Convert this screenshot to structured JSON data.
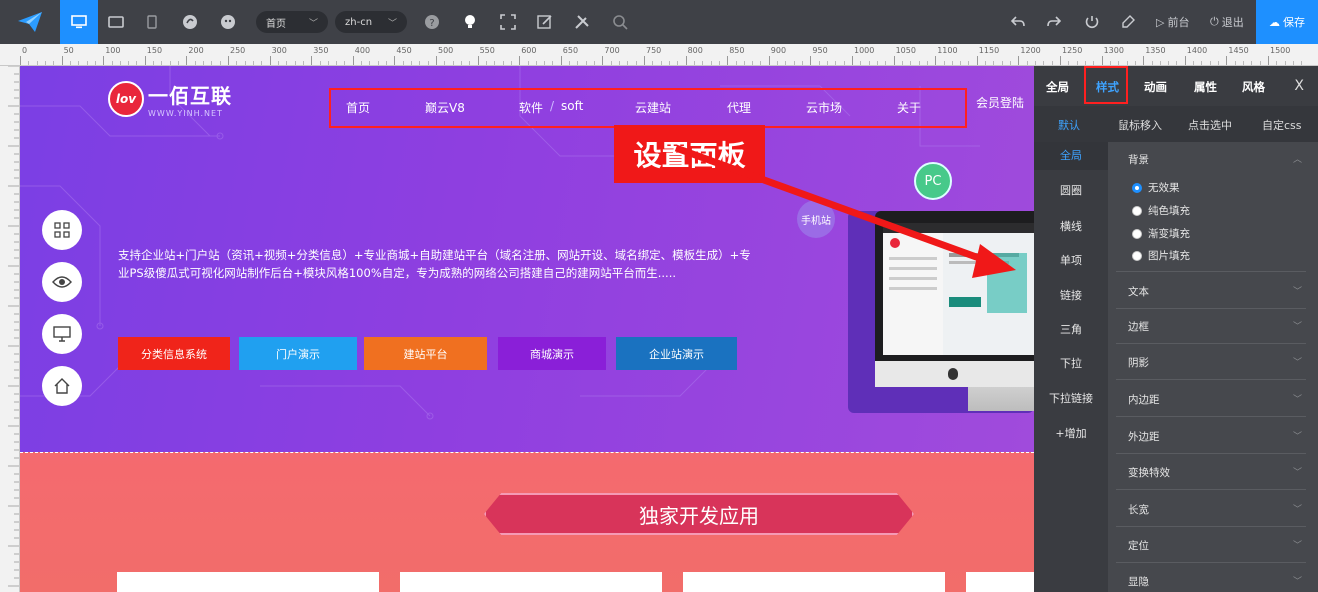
{
  "toolbar": {
    "lang_page": "首页",
    "lang_code": "zh-cn",
    "front_label": "前台",
    "logout_label": "退出",
    "save_label": "保存"
  },
  "ruler": {
    "marks": [
      "0",
      "50",
      "100",
      "150",
      "200",
      "250",
      "300",
      "350",
      "400",
      "450",
      "500",
      "550",
      "600",
      "650",
      "700",
      "750",
      "800",
      "850",
      "900",
      "950",
      "1000",
      "1050",
      "1100",
      "1150",
      "1200",
      "1250",
      "1300",
      "1350",
      "1400",
      "1450",
      "1500"
    ]
  },
  "site": {
    "brand_name": "一佰互联",
    "brand_sub": "WWW.YINH.NET",
    "brand_logo": "lov",
    "nav": [
      "首页",
      "巅云V8",
      "软件",
      "/",
      "soft",
      "云建站",
      "代理",
      "云市场",
      "关于"
    ],
    "member_login": "会员登陆",
    "intro": "支持企业站+门户站（资讯+视频+分类信息）+专业商城+自助建站平台（域名注册、网站开设、域名绑定、模板生成）+专业PS级傻瓜式可视化网站制作后台+模块风格100%自定，专为成熟的网络公司搭建自己的建网站平台而生.....",
    "cta": [
      {
        "label": "分类信息系统",
        "color": "#f0241a"
      },
      {
        "label": "门户演示",
        "color": "#20a0f0"
      },
      {
        "label": "建站平台",
        "color": "#f07020"
      },
      {
        "label": "商城演示",
        "color": "#8a1fd8"
      },
      {
        "label": "企业站演示",
        "color": "#1a72c0"
      }
    ],
    "pc_badge": "PC",
    "mobile_badge": "手机站",
    "callout": "设置面板",
    "section_title": "独家开发应用"
  },
  "panel": {
    "tabs": [
      "全局",
      "样式",
      "动画",
      "属性",
      "风格"
    ],
    "close": "X",
    "states": [
      "默认",
      "鼠标移入",
      "点击选中",
      "自定css"
    ],
    "side": [
      "全局",
      "圆圈",
      "横线",
      "单项",
      "链接",
      "三角",
      "下拉",
      "下拉链接",
      "+增加"
    ],
    "bg_title": "背景",
    "bg_options": [
      "无效果",
      "纯色填充",
      "渐变填充",
      "图片填充"
    ],
    "sections": [
      "文本",
      "边框",
      "阴影",
      "内边距",
      "外边距",
      "变换特效",
      "长宽",
      "定位",
      "显隐"
    ]
  },
  "colors": {
    "accent": "#1e90ff",
    "highlight_red": "#ff2020"
  }
}
